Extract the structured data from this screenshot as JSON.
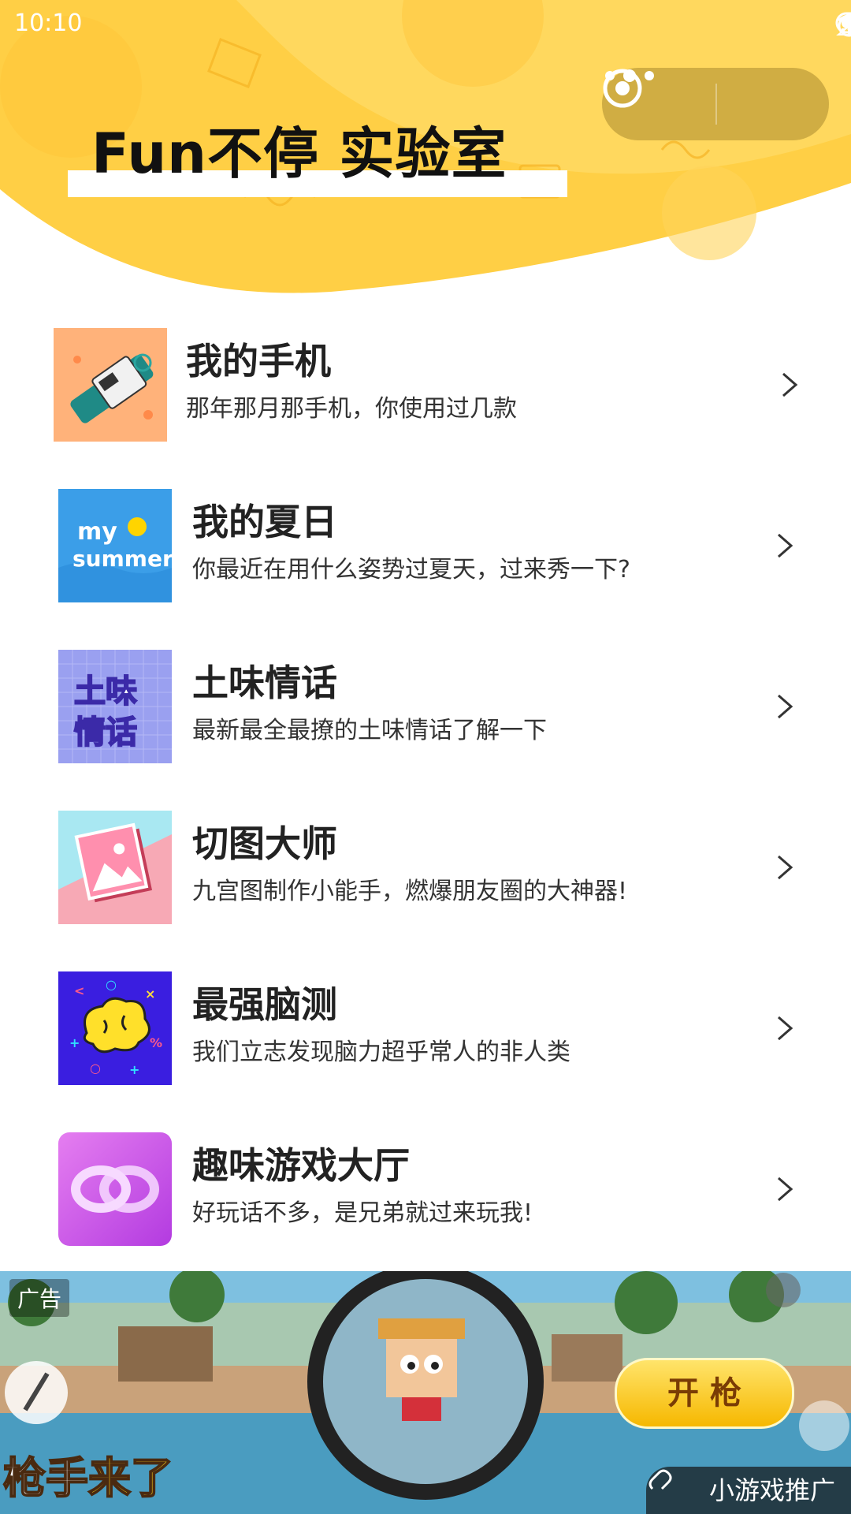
{
  "status_bar": {
    "time": "10:10"
  },
  "capsule": {
    "more_icon": "more-dots-icon",
    "close_icon": "target-circle-icon"
  },
  "header": {
    "title": "Fun不停 实验室"
  },
  "items": [
    {
      "name": "我的手机",
      "desc": "那年那月那手机，你使用过几款",
      "thumb_icon": "phone-thumbnail"
    },
    {
      "name": "我的夏日",
      "desc": "你最近在用什么姿势过夏天，过来秀一下?",
      "thumb_label_1": "my",
      "thumb_label_2": "summer"
    },
    {
      "name": "土味情话",
      "desc": "最新最全最撩的土味情话了解一下",
      "thumb_label_1": "土味",
      "thumb_label_2": "情话"
    },
    {
      "name": "切图大师",
      "desc": "九宫图制作小能手，燃爆朋友圈的大神器!",
      "thumb_icon": "image-frame-thumbnail"
    },
    {
      "name": "最强脑测",
      "desc": "我们立志发现脑力超乎常人的非人类",
      "thumb_icon": "brain-thumbnail"
    },
    {
      "name": "趣味游戏大厅",
      "desc": "好玩话不多，是兄弟就过来玩我!",
      "thumb_icon": "rings-thumbnail"
    }
  ],
  "ad": {
    "tag": "广告",
    "title_part1": "枪手",
    "title_part2": "来了",
    "button": "开 枪",
    "promo": "小游戏推广"
  },
  "colors": {
    "header_yellow": "#ffd24a",
    "header_light": "#ffe27a",
    "capsule_bg": "#c3a03c"
  }
}
